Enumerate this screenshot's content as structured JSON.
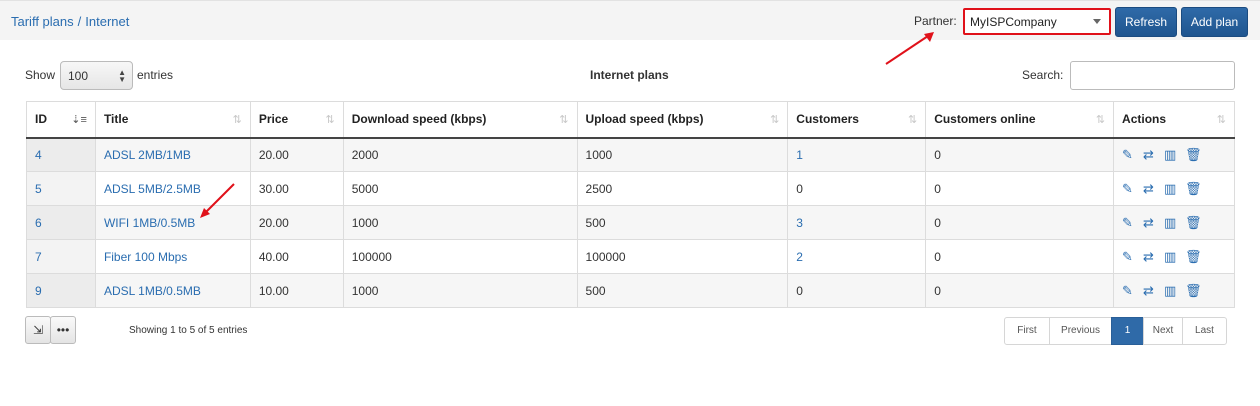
{
  "breadcrumb": {
    "section": "Tariff plans",
    "separator": "/",
    "page": "Internet"
  },
  "partner": {
    "label": "Partner:",
    "selected": "MyISPCompany"
  },
  "buttons": {
    "refresh": "Refresh",
    "add_plan": "Add plan"
  },
  "length": {
    "show_label": "Show",
    "value": "100",
    "entries_label": "entries"
  },
  "table_title": "Internet plans",
  "search": {
    "label": "Search:",
    "value": ""
  },
  "columns": [
    "ID",
    "Title",
    "Price",
    "Download speed (kbps)",
    "Upload speed (kbps)",
    "Customers",
    "Customers online",
    "Actions"
  ],
  "rows": [
    {
      "id": "4",
      "title": "ADSL 2MB/1MB",
      "price": "20.00",
      "download": "2000",
      "upload": "1000",
      "customers": "1",
      "online": "0"
    },
    {
      "id": "5",
      "title": "ADSL 5MB/2.5MB",
      "price": "30.00",
      "download": "5000",
      "upload": "2500",
      "customers": "0",
      "online": "0"
    },
    {
      "id": "6",
      "title": "WIFI 1MB/0.5MB",
      "price": "20.00",
      "download": "1000",
      "upload": "500",
      "customers": "3",
      "online": "0"
    },
    {
      "id": "7",
      "title": "Fiber 100 Mbps",
      "price": "40.00",
      "download": "100000",
      "upload": "100000",
      "customers": "2",
      "online": "0"
    },
    {
      "id": "9",
      "title": "ADSL 1MB/0.5MB",
      "price": "10.00",
      "download": "1000",
      "upload": "500",
      "customers": "0",
      "online": "0"
    }
  ],
  "actions_icons": [
    "edit-icon",
    "transfer-icon",
    "stats-icon",
    "delete-icon"
  ],
  "info": "Showing 1 to 5 of 5 entries",
  "pagination": {
    "first": "First",
    "previous": "Previous",
    "current": "1",
    "next": "Next",
    "last": "Last"
  },
  "colors": {
    "accent": "#2f6aa8",
    "link": "#2a6db0",
    "highlight": "#e0111a"
  }
}
